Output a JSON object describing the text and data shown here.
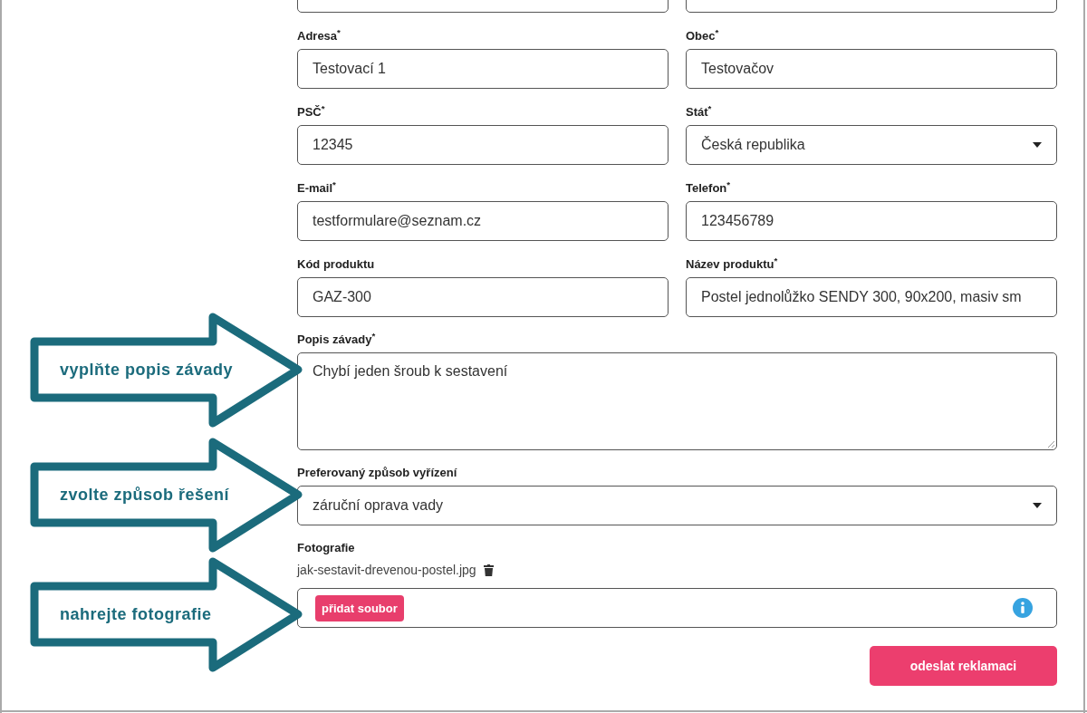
{
  "cut_fields": [
    {
      "kind": "text"
    },
    {
      "kind": "text"
    }
  ],
  "address_fields": [
    {
      "label": "Adresa$^{*}$",
      "kind": "text",
      "value": "Testovací 1"
    },
    {
      "label": "Obec$^{*}$",
      "kind": "text",
      "value": "Testovačov"
    },
    {
      "label": "PSČ$^{*}$",
      "kind": "text",
      "value": "12345"
    },
    {
      "label": "Stát$^{*}$",
      "kind": "select",
      "value": "Česká republika"
    },
    {
      "label": "E-mail$^{*}$",
      "kind": "text",
      "value": "testformulare@seznam.cz"
    },
    {
      "label": "Telefon$^{*}$",
      "kind": "text",
      "value": "123456789"
    },
    {
      "label": "Kód produktu",
      "kind": "text",
      "value": "GAZ-300"
    },
    {
      "label": "Název produktu$^{*}$",
      "kind": "text",
      "value": "Postel jednolůžko SENDY 300, 90x200, masiv sm"
    }
  ],
  "description": {
    "label": "Popis závady$^{*}$",
    "value": "Chybí jeden šroub k sestavení"
  },
  "resolution": {
    "label": "Preferovaný způsob vyřízení",
    "value": "záruční oprava vady"
  },
  "photos": {
    "label": "Fotografie",
    "files": [
      "jak-sestavit-drevenou-postel.jpg"
    ],
    "add_button": "přidat soubor"
  },
  "submit_button": "odeslat reklamaci",
  "annotations": [
    "vyplňte popis závady",
    "zvolte způsob řešení",
    "nahrejte fotografie"
  ]
}
